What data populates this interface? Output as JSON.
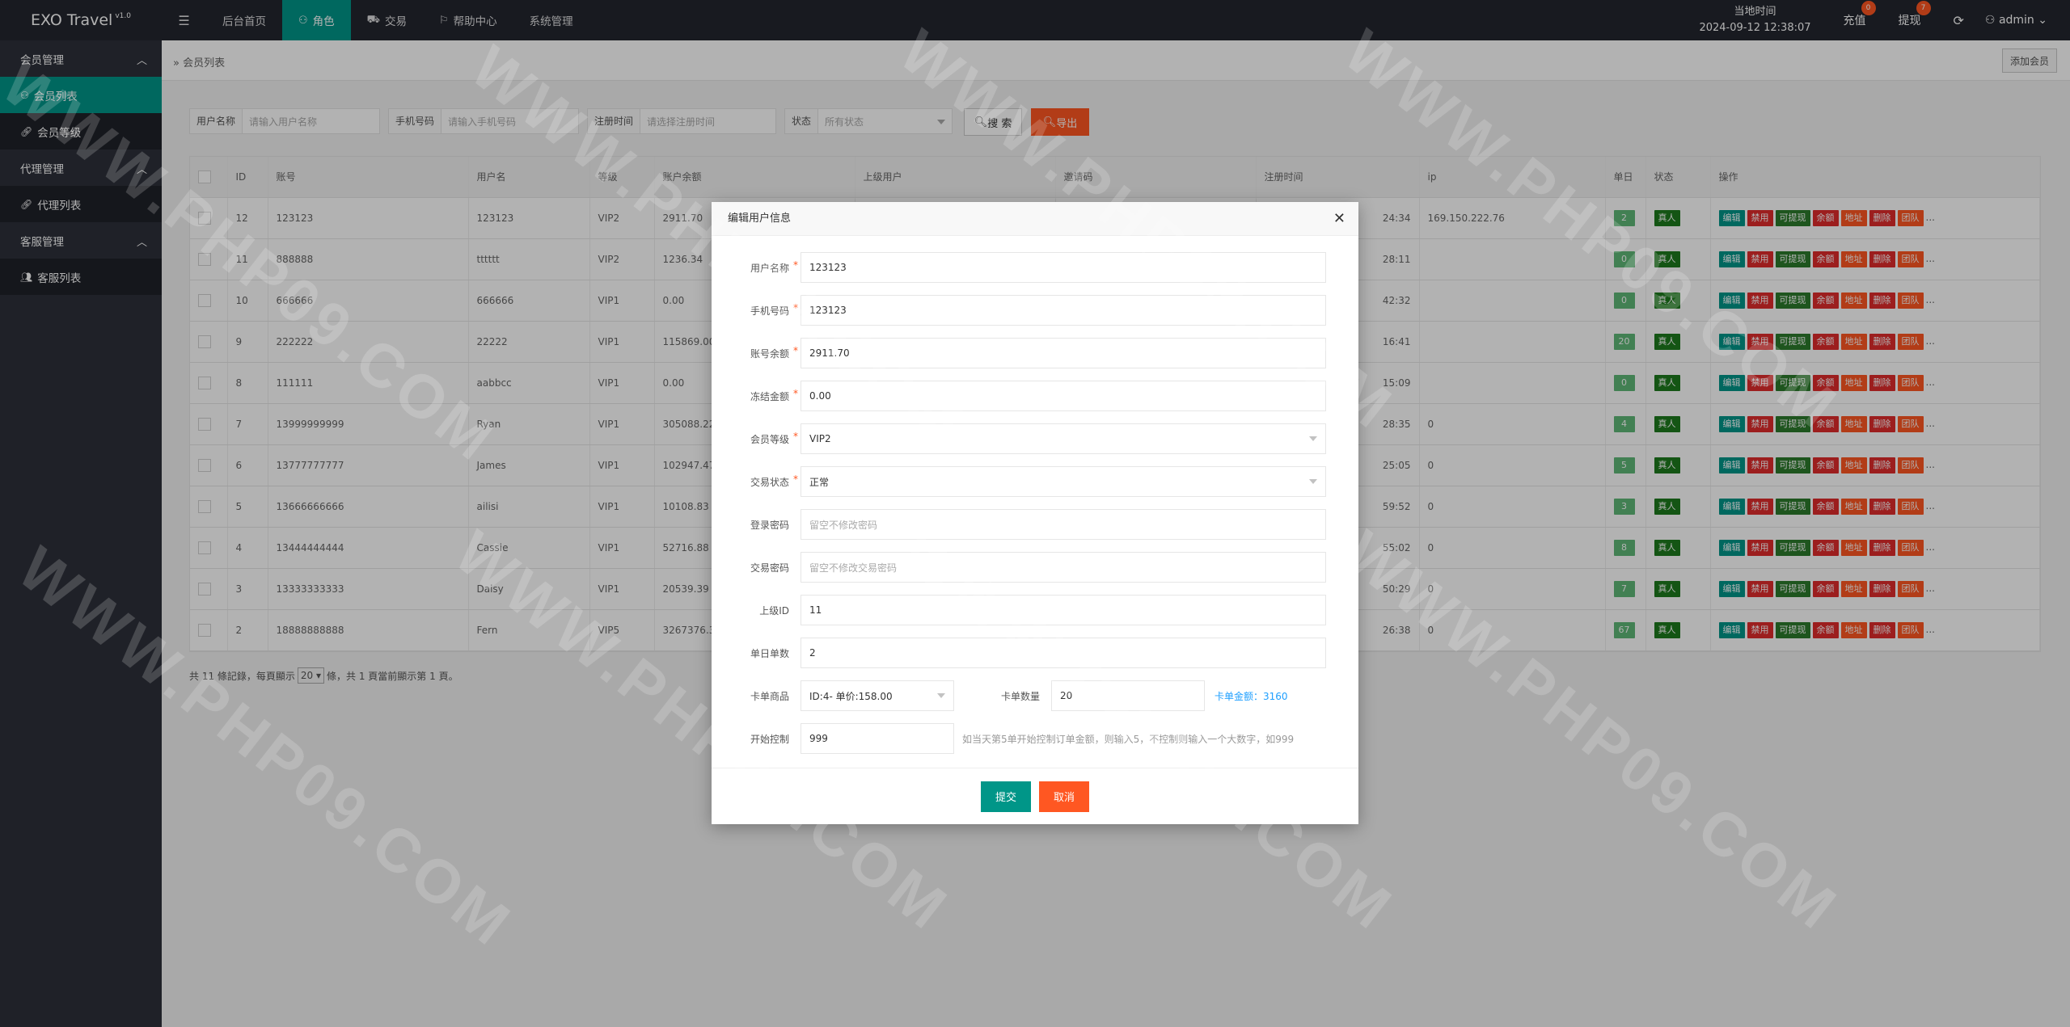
{
  "app": {
    "title": "EXO Travel",
    "version": "v1.0"
  },
  "header": {
    "menu_icon": "hamburger-icon",
    "nav": [
      {
        "label": "后台首页",
        "icon": ""
      },
      {
        "label": "角色",
        "icon": "user-icon"
      },
      {
        "label": "交易",
        "icon": "car-icon"
      },
      {
        "label": "帮助中心",
        "icon": "flag-icon"
      },
      {
        "label": "系统管理",
        "icon": ""
      }
    ],
    "clock_label": "当地时间",
    "clock_value": "2024-09-12 12:38:07",
    "recharge_label": "充值",
    "recharge_badge": "0",
    "withdraw_label": "提现",
    "withdraw_badge": "7",
    "user_label": "admin"
  },
  "sidebar": {
    "groups": [
      {
        "label": "会员管理",
        "items": [
          {
            "label": "会员列表"
          },
          {
            "label": "会员等级"
          }
        ]
      },
      {
        "label": "代理管理",
        "items": [
          {
            "label": "代理列表"
          }
        ]
      },
      {
        "label": "客服管理",
        "items": [
          {
            "label": "客服列表"
          }
        ]
      }
    ]
  },
  "breadcrumb": "会员列表",
  "add_button": "添加会员",
  "filters": {
    "username_label": "用户名称",
    "username_placeholder": "请输入用户名称",
    "phone_label": "手机号码",
    "phone_placeholder": "请输入手机号码",
    "regtime_label": "注册时间",
    "regtime_placeholder": "请选择注册时间",
    "status_label": "状态",
    "status_placeholder": "所有状态",
    "search_button": "搜 索",
    "export_button": "导出"
  },
  "table": {
    "headers": [
      "ID",
      "账号",
      "用户名",
      "等级",
      "账户余额",
      "上级用户",
      "邀请码",
      "注册时间",
      "ip",
      "单日",
      "状态",
      "操作"
    ],
    "rows": [
      {
        "id": "12",
        "account": "123123",
        "username": "123123",
        "level": "VIP2",
        "balance": "2911.70",
        "regtime": "24:34",
        "ip": "169.150.222.76",
        "daily": "2",
        "status": "真人"
      },
      {
        "id": "11",
        "account": "888888",
        "username": "tttttt",
        "level": "VIP2",
        "balance": "1236.34",
        "regtime": "28:11",
        "ip": "",
        "daily": "0",
        "status": "真人"
      },
      {
        "id": "10",
        "account": "666666",
        "username": "666666",
        "level": "VIP1",
        "balance": "0.00",
        "regtime": "42:32",
        "ip": "",
        "daily": "0",
        "status": "真人"
      },
      {
        "id": "9",
        "account": "222222",
        "username": "22222",
        "level": "VIP1",
        "balance": "115869.00",
        "regtime": "16:41",
        "ip": "",
        "daily": "20",
        "status": "真人"
      },
      {
        "id": "8",
        "account": "111111",
        "username": "aabbcc",
        "level": "VIP1",
        "balance": "0.00",
        "regtime": "15:09",
        "ip": "",
        "daily": "0",
        "status": "真人"
      },
      {
        "id": "7",
        "account": "13999999999",
        "username": "Ryan",
        "level": "VIP1",
        "balance": "305088.22",
        "regtime": "28:35",
        "ip": "0",
        "daily": "4",
        "status": "真人"
      },
      {
        "id": "6",
        "account": "13777777777",
        "username": "James",
        "level": "VIP1",
        "balance": "102947.47",
        "regtime": "25:05",
        "ip": "0",
        "daily": "5",
        "status": "真人"
      },
      {
        "id": "5",
        "account": "13666666666",
        "username": "ailisi",
        "level": "VIP1",
        "balance": "10108.83",
        "regtime": "59:52",
        "ip": "0",
        "daily": "3",
        "status": "真人"
      },
      {
        "id": "4",
        "account": "13444444444",
        "username": "Cassie",
        "level": "VIP1",
        "balance": "52716.88",
        "regtime": "55:02",
        "ip": "0",
        "daily": "8",
        "status": "真人"
      },
      {
        "id": "3",
        "account": "13333333333",
        "username": "Daisy",
        "level": "VIP1",
        "balance": "20539.39",
        "regtime": "50:29",
        "ip": "0",
        "daily": "7",
        "status": "真人"
      },
      {
        "id": "2",
        "account": "18888888888",
        "username": "Fern",
        "level": "VIP5",
        "balance": "3267376.3",
        "regtime": "26:38",
        "ip": "0",
        "daily": "67",
        "status": "真人"
      }
    ],
    "actions": [
      "编辑",
      "禁用",
      "可提现",
      "余额",
      "地址",
      "删除",
      "团队"
    ],
    "more": "..."
  },
  "pager": {
    "prefix": "共 11 條記錄，每頁顯示",
    "size": "20",
    "suffix": "條，共 1 頁當前顯示第 1 頁。"
  },
  "modal": {
    "title": "编辑用户信息",
    "fields": {
      "username_label": "用户名称",
      "username_value": "123123",
      "phone_label": "手机号码",
      "phone_value": "123123",
      "balance_label": "账号余额",
      "balance_value": "2911.70",
      "frozen_label": "冻结金额",
      "frozen_value": "0.00",
      "level_label": "会员等级",
      "level_value": "VIP2",
      "trade_label": "交易状态",
      "trade_value": "正常",
      "loginpwd_label": "登录密码",
      "loginpwd_placeholder": "留空不修改密码",
      "tradepwd_label": "交易密码",
      "tradepwd_placeholder": "留空不修改交易密码",
      "parent_label": "上级ID",
      "parent_value": "11",
      "daily_label": "单日单数",
      "daily_value": "2",
      "card_product_label": "卡单商品",
      "card_product_value": "ID:4- 单价:158.00",
      "card_count_label": "卡单数量",
      "card_count_value": "20",
      "card_total_label": "卡单金额：",
      "card_total_value": "3160",
      "start_label": "开始控制",
      "start_value": "999",
      "start_hint": "如当天第5单开始控制订单金额，则输入5，不控制则输入一个大数字，如999"
    },
    "submit": "提交",
    "cancel": "取消",
    "close_icon": "close-icon"
  },
  "watermark": "WWW.PHP09.COM",
  "colors": {
    "teal": "#009688",
    "orange": "#ff5722",
    "red": "#e02b2b",
    "header_bg": "#23262e",
    "sidebar_bg": "#2d303a"
  }
}
